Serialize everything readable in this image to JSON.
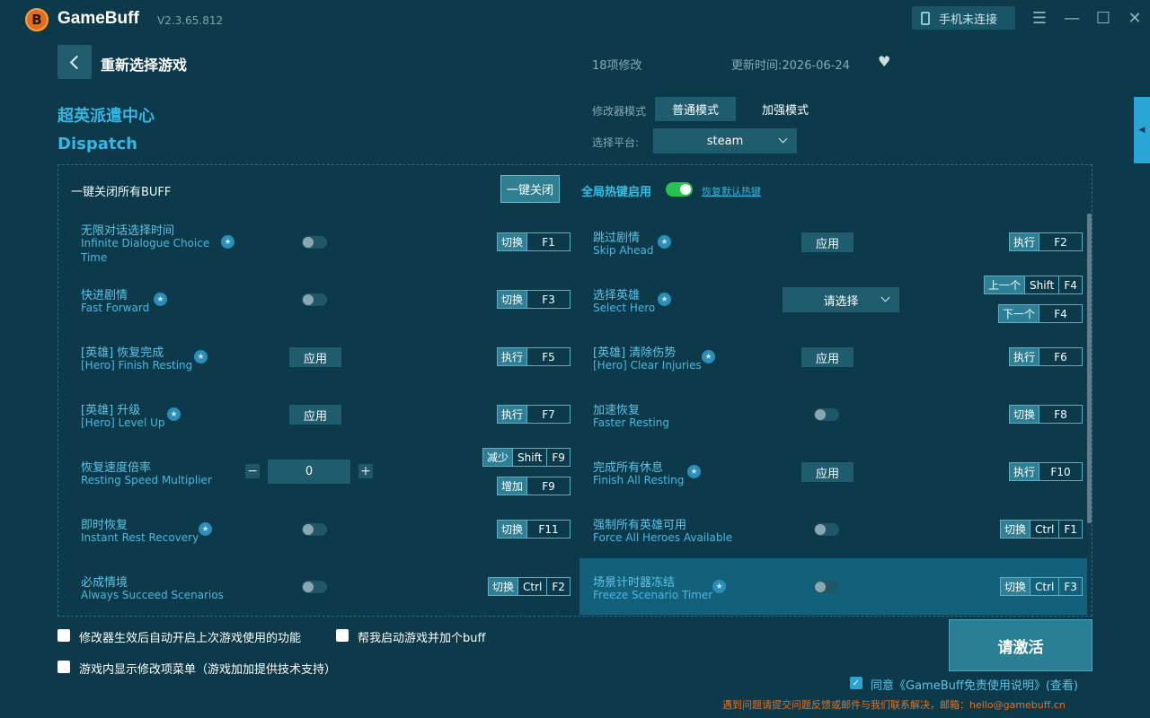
{
  "app": {
    "name": "GameBuff",
    "version": "V2.3.65.812",
    "logo_letter": "B",
    "phone_status": "手机未连接"
  },
  "header": {
    "back_label": "重新选择游戏",
    "mod_count": "18项修改",
    "update_time": "更新时间:2026-06-24"
  },
  "game": {
    "name_cn": "超英派遣中心",
    "name_en": "Dispatch"
  },
  "mode": {
    "label": "修改器模式",
    "options": [
      "普通模式",
      "加强模式"
    ],
    "selected": "普通模式"
  },
  "platform": {
    "label": "选择平台:",
    "value": "steam"
  },
  "controls": {
    "close_all_label": "一键关闭所有BUFF",
    "close_all_button": "一键关闭",
    "hotkey_label": "全局热键启用",
    "hotkey_enabled": true,
    "restore_hotkeys": "恢复默认热键"
  },
  "cheats": {
    "c1": {
      "cn": "无限对话选择时间",
      "en1": "Infinite Dialogue Choice",
      "en2": "Time",
      "action": "切换",
      "keys": [
        "F1"
      ]
    },
    "c2": {
      "cn": "快进剧情",
      "en": "Fast Forward",
      "action": "切换",
      "keys": [
        "F3"
      ]
    },
    "c3": {
      "cn": "[英雄] 恢复完成",
      "en": "[Hero] Finish Resting",
      "button": "应用",
      "action": "执行",
      "keys": [
        "F5"
      ]
    },
    "c4": {
      "cn": "[英雄] 升级",
      "en": "[Hero] Level Up",
      "button": "应用",
      "action": "执行",
      "keys": [
        "F7"
      ]
    },
    "c5": {
      "cn": "恢复速度倍率",
      "en": "Resting Speed Multiplier",
      "value": "0",
      "minus": "−",
      "plus": "+",
      "dec_action": "减少",
      "dec_keys": [
        "Shift",
        "F9"
      ],
      "inc_action": "增加",
      "inc_keys": [
        "F9"
      ]
    },
    "c6": {
      "cn": "即时恢复",
      "en": "Instant Rest Recovery",
      "action": "切换",
      "keys": [
        "F11"
      ]
    },
    "c7": {
      "cn": "必成情境",
      "en": "Always Succeed Scenarios",
      "action": "切换",
      "keys": [
        "Ctrl",
        "F2"
      ]
    },
    "c8": {
      "cn": "跳过剧情",
      "en": "Skip Ahead",
      "button": "应用",
      "action": "执行",
      "keys": [
        "F2"
      ]
    },
    "c9": {
      "cn": "选择英雄",
      "en": "Select Hero",
      "select": "请选择",
      "prev_action": "上一个",
      "prev_keys": [
        "Shift",
        "F4"
      ],
      "next_action": "下一个",
      "next_keys": [
        "F4"
      ]
    },
    "c10": {
      "cn": "[英雄] 清除伤势",
      "en": "[Hero] Clear Injuries",
      "button": "应用",
      "action": "执行",
      "keys": [
        "F6"
      ]
    },
    "c11": {
      "cn": "加速恢复",
      "en": "Faster Resting",
      "action": "切换",
      "keys": [
        "F8"
      ]
    },
    "c12": {
      "cn": "完成所有休息",
      "en": "Finish All Resting",
      "button": "应用",
      "action": "执行",
      "keys": [
        "F10"
      ]
    },
    "c13": {
      "cn": "强制所有英雄可用",
      "en": "Force All Heroes Available",
      "action": "切换",
      "keys": [
        "Ctrl",
        "F1"
      ]
    },
    "c14": {
      "cn": "场景计时器冻结",
      "en": "Freeze Scenario Timer",
      "action": "切换",
      "keys": [
        "Ctrl",
        "F3"
      ]
    }
  },
  "footer": {
    "auto_enable": "修改器生效后自动开启上次游戏使用的功能",
    "launch_buff": "帮我启动游戏并加个buff",
    "ingame_menu": "游戏内显示修改项菜单（游戏加加提供技术支持）",
    "activate_button": "请激活",
    "agree_text": "同意《GameBuff免责使用说明》(查看)",
    "contact": "遇到问题请提交问题反馈或邮件与我们联系解决，邮箱：hello@gamebuff.cn"
  },
  "icons": [
    "logo-icon",
    "phone-icon",
    "menu-icon",
    "minimize-icon",
    "maximize-icon",
    "close-icon",
    "back-icon",
    "heart-icon",
    "star-icon",
    "chevron-down-icon",
    "side-panel-icon"
  ],
  "colors": {
    "background": "#0c3a4a",
    "accent": "#33b7e3",
    "toggle_on": "#27c24c",
    "contact_text": "#e8701f"
  }
}
